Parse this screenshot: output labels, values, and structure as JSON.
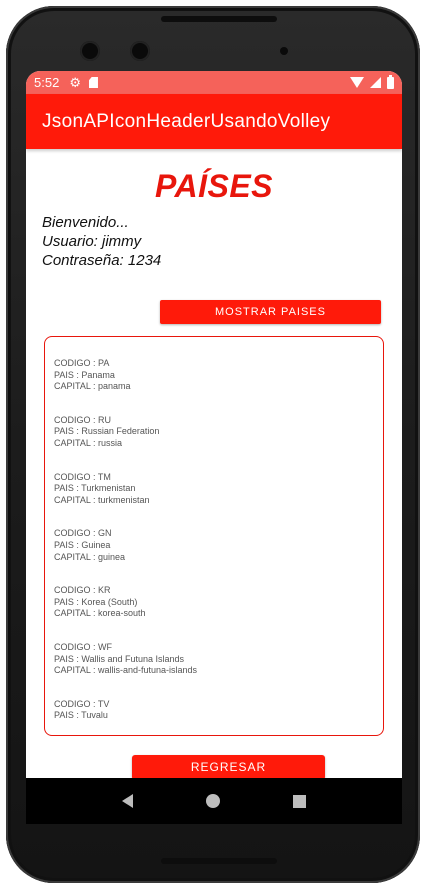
{
  "statusbar": {
    "time": "5:52",
    "icons": [
      "gear-icon",
      "sd-card-icon",
      "wifi-icon",
      "signal-icon",
      "battery-icon"
    ]
  },
  "appbar": {
    "title": "JsonAPIconHeaderUsandoVolley"
  },
  "main": {
    "heading": "PAÍSES",
    "welcome": "Bienvenido...",
    "user_line": "Usuario: jimmy",
    "password_line": "Contraseña: 1234",
    "show_button": "MOSTRAR PAISES",
    "back_button": "REGRESAR"
  },
  "countries": [
    {
      "code": "CODIGO : PA",
      "name": "PAIS : Panama",
      "capital": "CAPITAL : panama"
    },
    {
      "code": "CODIGO : RU",
      "name": "PAIS : Russian Federation",
      "capital": "CAPITAL : russia"
    },
    {
      "code": "CODIGO : TM",
      "name": "PAIS : Turkmenistan",
      "capital": "CAPITAL : turkmenistan"
    },
    {
      "code": "CODIGO : GN",
      "name": "PAIS : Guinea",
      "capital": "CAPITAL : guinea"
    },
    {
      "code": "CODIGO : KR",
      "name": "PAIS : Korea (South)",
      "capital": "CAPITAL : korea-south"
    },
    {
      "code": "CODIGO : WF",
      "name": "PAIS : Wallis and Futuna Islands",
      "capital": "CAPITAL : wallis-and-futuna-islands"
    },
    {
      "code": "CODIGO : TV",
      "name": "PAIS : Tuvalu",
      "capital": ""
    }
  ],
  "navbar": {
    "icons": [
      "back-icon",
      "home-icon",
      "recents-icon"
    ]
  },
  "colors": {
    "accent": "#ff1a0a",
    "statusbar": "#f5625a",
    "heading": "#e8160c"
  }
}
